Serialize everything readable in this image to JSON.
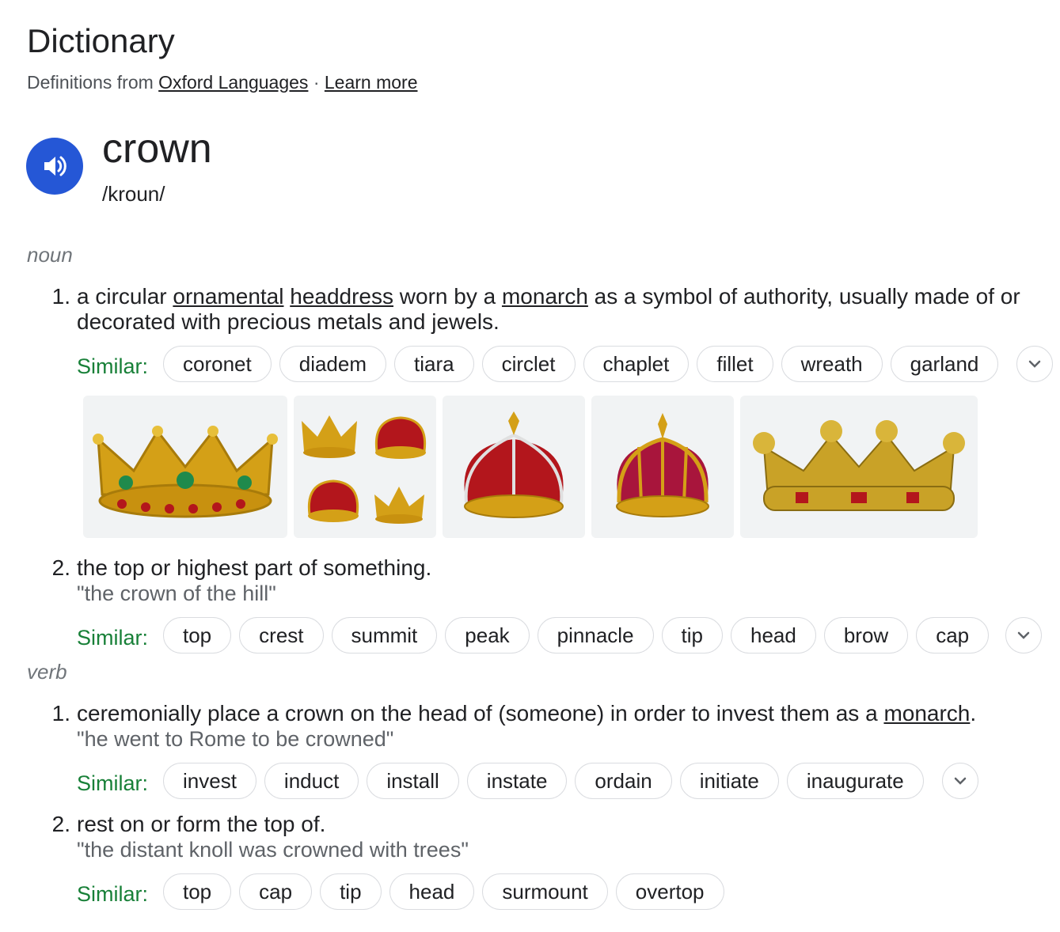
{
  "header": {
    "title": "Dictionary",
    "source_prefix": "Definitions from",
    "source_link": "Oxford Languages",
    "separator": "·",
    "learn_more": "Learn more"
  },
  "entry": {
    "word": "crown",
    "phonetic": "/kroun/",
    "speaker_icon": "speaker-icon"
  },
  "similar_label": "Similar:",
  "noun": {
    "label": "noun",
    "sense1": {
      "number": "1.",
      "p1": "a circular ",
      "l1": "ornamental",
      "p2": " ",
      "l2": "headdress",
      "p3": " worn by a ",
      "l3": "monarch",
      "p4": " as a symbol of authority, usually made of or decorated with precious metals and jewels.",
      "similar": [
        "coronet",
        "diadem",
        "tiara",
        "circlet",
        "chaplet",
        "fillet",
        "wreath",
        "garland"
      ]
    },
    "images": [
      "crown-image-1",
      "crown-image-2",
      "crown-image-3",
      "crown-image-4",
      "crown-image-5"
    ],
    "sense2": {
      "number": "2.",
      "text": "the top or highest part of something.",
      "example": "\"the crown of the hill\"",
      "similar": [
        "top",
        "crest",
        "summit",
        "peak",
        "pinnacle",
        "tip",
        "head",
        "brow",
        "cap"
      ]
    }
  },
  "verb": {
    "label": "verb",
    "sense1": {
      "number": "1.",
      "p1": "ceremonially place a crown on the head of (someone) in order to invest them as a ",
      "l1": "monarch",
      "p2": ".",
      "example": "\"he went to Rome to be crowned\"",
      "similar": [
        "invest",
        "induct",
        "install",
        "instate",
        "ordain",
        "initiate",
        "inaugurate"
      ]
    },
    "sense2": {
      "number": "2.",
      "text": "rest on or form the top of.",
      "example": "\"the distant knoll was crowned with trees\"",
      "similar": [
        "top",
        "cap",
        "tip",
        "head",
        "surmount",
        "overtop"
      ]
    }
  },
  "colors": {
    "speaker_bg": "#2557d6",
    "similar_green": "#188038",
    "example_gray": "#5f6368",
    "pos_gray": "#70757a",
    "chip_border": "#dadce0",
    "gold": "#d4a017",
    "red": "#b3161c"
  },
  "icons": {
    "expand": "chevron-down-icon"
  }
}
